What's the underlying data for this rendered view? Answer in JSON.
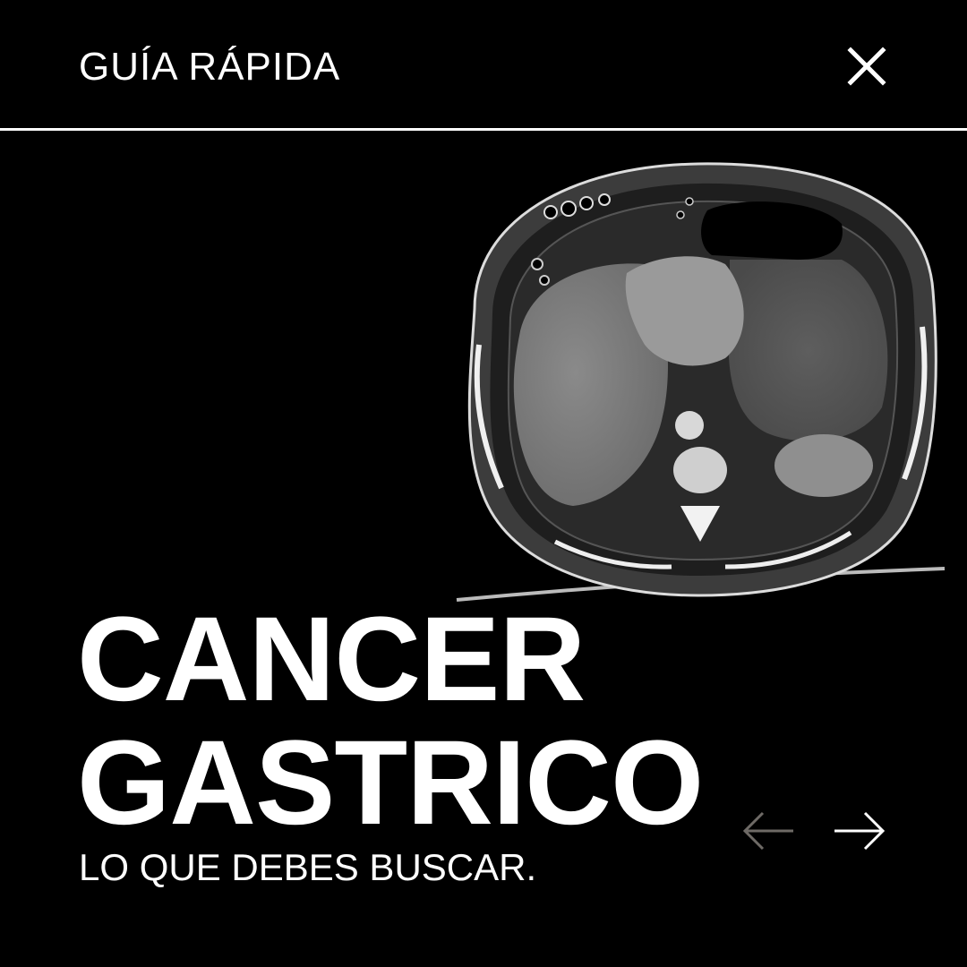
{
  "header": {
    "title": "GUÍA RÁPIDA",
    "close_icon": "close-icon"
  },
  "image": {
    "icon": "ct-scan-image"
  },
  "headline": {
    "line1": "CANCER",
    "line2": "GASTRICO"
  },
  "subtitle": "LO QUE DEBES BUSCAR.",
  "navigation": {
    "prev_icon": "arrow-left-icon",
    "next_icon": "arrow-right-icon",
    "prev_color": "#6e6a66",
    "next_color": "#ffffff"
  },
  "colors": {
    "background": "#000000",
    "text": "#ffffff"
  }
}
